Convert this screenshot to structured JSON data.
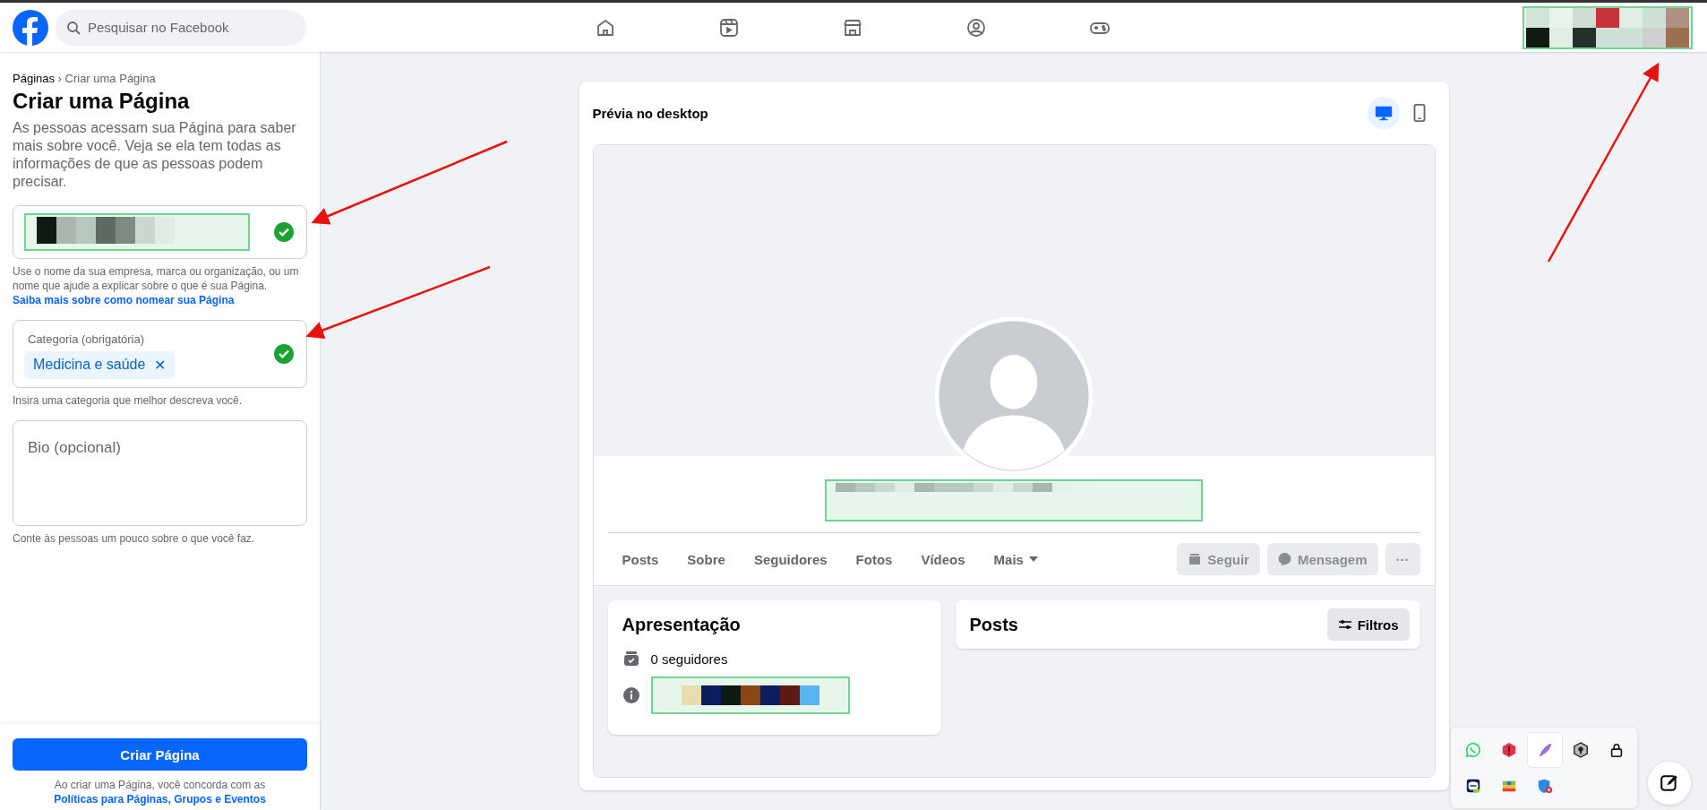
{
  "header": {
    "search": {
      "placeholder": "Pesquisar no Facebook"
    },
    "nav": [
      {
        "kind": "home"
      },
      {
        "kind": "video"
      },
      {
        "kind": "store"
      },
      {
        "kind": "groups"
      },
      {
        "kind": "gaming"
      }
    ]
  },
  "form": {
    "breadcrumb": {
      "parent": "Páginas",
      "separator": "›",
      "current": "Criar uma Página"
    },
    "title": "Criar uma Página",
    "description": "As pessoas acessam sua Página para saber mais sobre você. Veja se ela tem todas as informações de que as pessoas podem precisar.",
    "name_field": {
      "valid": true,
      "helper": "Use o nome da sua empresa, marca ou organização, ou um nome que ajude a explicar sobre o que é sua Página.",
      "helper_link": "Saiba mais sobre como nomear sua Página"
    },
    "category_field": {
      "label": "Categoria (obrigatória)",
      "chip": "Medicina e saúde",
      "chip_remove": "✕",
      "valid": true,
      "helper": "Insira uma categoria que melhor descreva você."
    },
    "bio_field": {
      "placeholder": "Bio (opcional)",
      "helper": "Conte às pessoas um pouco sobre o que você faz."
    },
    "submit": "Criar Página",
    "terms": "Ao criar uma Página, você concorda com as",
    "terms_link": "Políticas para Páginas, Grupos e Eventos"
  },
  "preview": {
    "title": "Prévia no desktop",
    "devices": [
      {
        "kind": "desktop",
        "selected": true
      },
      {
        "kind": "mobile",
        "selected": false
      }
    ],
    "tabs": [
      {
        "label": "Posts"
      },
      {
        "label": "Sobre"
      },
      {
        "label": "Seguidores"
      },
      {
        "label": "Fotos"
      },
      {
        "label": "Vídeos"
      },
      {
        "label": "Mais",
        "dropdown": true
      }
    ],
    "actions": [
      {
        "kind": "follow",
        "label": "Seguir",
        "disabled": true
      },
      {
        "kind": "message",
        "label": "Mensagem",
        "disabled": true
      },
      {
        "kind": "more",
        "label": "···",
        "disabled": true
      }
    ],
    "intro": {
      "title": "Apresentação",
      "followers": "0 seguidores"
    },
    "posts": {
      "title": "Posts",
      "filter": "Filtros"
    }
  },
  "tray": [
    {
      "kind": "whatsapp",
      "selected": false
    },
    {
      "kind": "alert",
      "selected": false
    },
    {
      "kind": "feather",
      "selected": true
    },
    {
      "kind": "hex",
      "selected": false
    },
    {
      "kind": "lock",
      "selected": false
    },
    {
      "kind": "remote",
      "selected": false
    },
    {
      "kind": "layers",
      "selected": false
    },
    {
      "kind": "shield",
      "selected": false
    }
  ]
}
